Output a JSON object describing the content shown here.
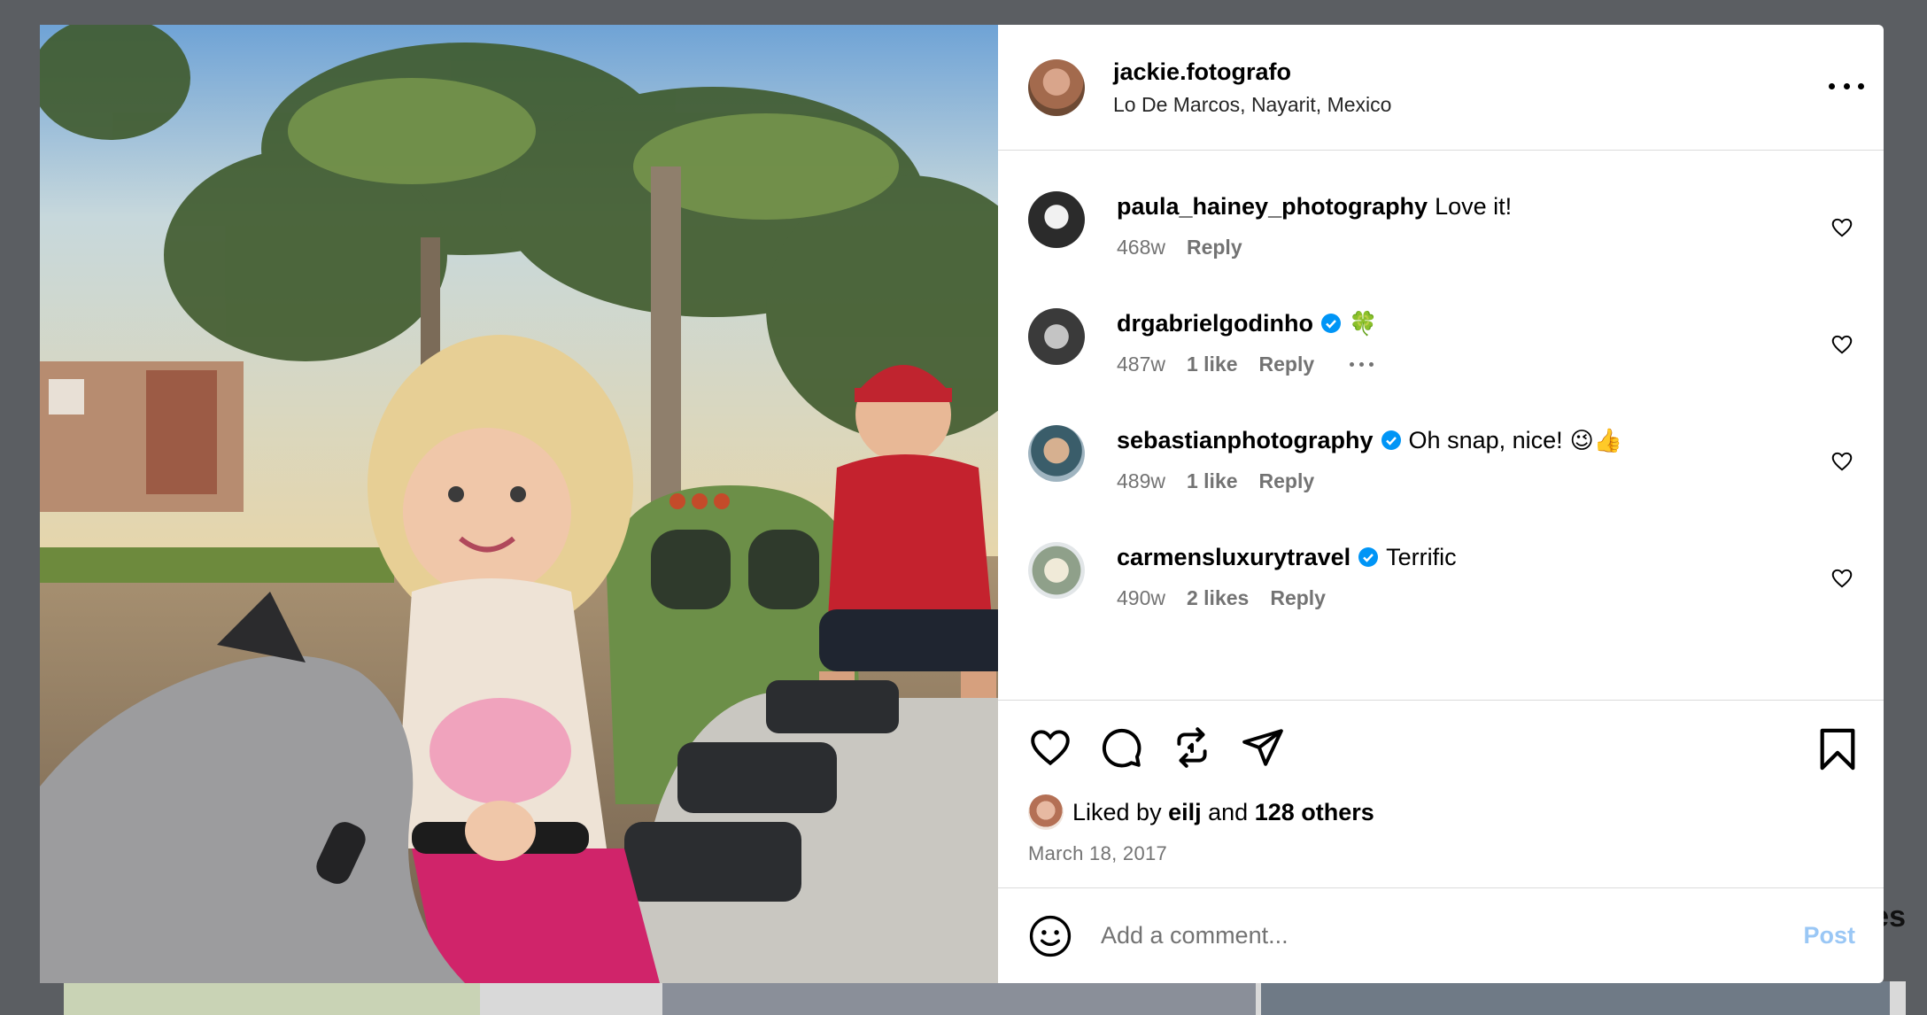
{
  "post": {
    "author": "jackie.fotografo",
    "location": "Lo De Marcos, Nayarit, Mexico",
    "image_alt": "Two children riding a playground train"
  },
  "comments": [
    {
      "user": "paula_hainey_photography",
      "verified": false,
      "text": "Love it!",
      "emoji": "",
      "age": "468w",
      "likes": "",
      "reply": "Reply",
      "has_more": false
    },
    {
      "user": "drgabrielgodinho",
      "verified": true,
      "text": "",
      "emoji": "🍀",
      "age": "487w",
      "likes": "1 like",
      "reply": "Reply",
      "has_more": true
    },
    {
      "user": "sebastianphotography",
      "verified": true,
      "text": "Oh snap, nice!",
      "emoji": "😉👍",
      "age": "489w",
      "likes": "1 like",
      "reply": "Reply",
      "has_more": false
    },
    {
      "user": "carmensluxurytravel",
      "verified": true,
      "text": "Terrific",
      "emoji": "",
      "age": "490w",
      "likes": "2 likes",
      "reply": "Reply",
      "has_more": false
    }
  ],
  "likes": {
    "prefix": "Liked by",
    "user": "eilj",
    "and": "and",
    "others": "128 others"
  },
  "date": "March 18, 2017",
  "add_comment": {
    "placeholder": "Add a comment...",
    "post_label": "Post"
  },
  "background": {
    "partial_text": "es"
  },
  "colors": {
    "verified": "#0095f6",
    "post_disabled": "#9ac7f5",
    "secondary_text": "#737373",
    "overlay": "#5b5e62"
  }
}
